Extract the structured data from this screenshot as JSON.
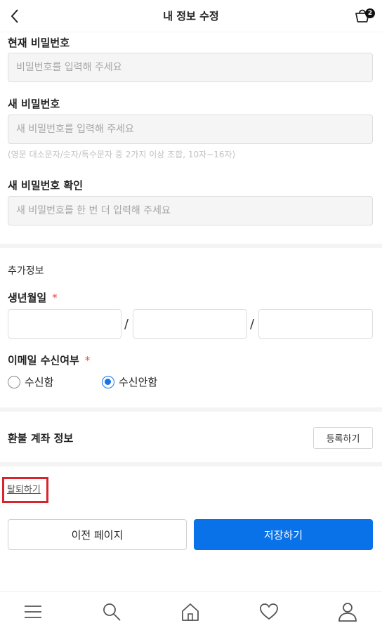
{
  "header": {
    "title": "내 정보 수정",
    "cart_count": "2"
  },
  "password": {
    "current_label": "현재 비밀번호",
    "current_placeholder": "비밀번호를 입력해 주세요",
    "new_label": "새 비밀번호",
    "new_placeholder": "새 비밀번호를 입력해 주세요",
    "hint": "(영문 대소문자/숫자/특수문자 중 2가지 이상 조합, 10자~16자)",
    "confirm_label": "새 비밀번호 확인",
    "confirm_placeholder": "새 비밀번호를 한 번 더 입력해 주세요"
  },
  "extra": {
    "title": "추가정보",
    "birth_label": "생년월일",
    "required_mark": "*",
    "separator": "/",
    "email_label": "이메일 수신여부",
    "email_options": [
      "수신함",
      "수신안함"
    ],
    "email_selected": "수신안함"
  },
  "refund": {
    "label": "환불 계좌 정보",
    "register_button": "등록하기"
  },
  "withdraw_link": "탈퇴하기",
  "actions": {
    "prev_button": "이전 페이지",
    "save_button": "저장하기"
  },
  "tabbar": {
    "icons": [
      "menu-icon",
      "search-icon",
      "home-icon",
      "heart-icon",
      "user-icon"
    ]
  },
  "colors": {
    "accent": "#0a72e8",
    "required": "#e84a4a",
    "highlight_box": "#d9232d"
  }
}
